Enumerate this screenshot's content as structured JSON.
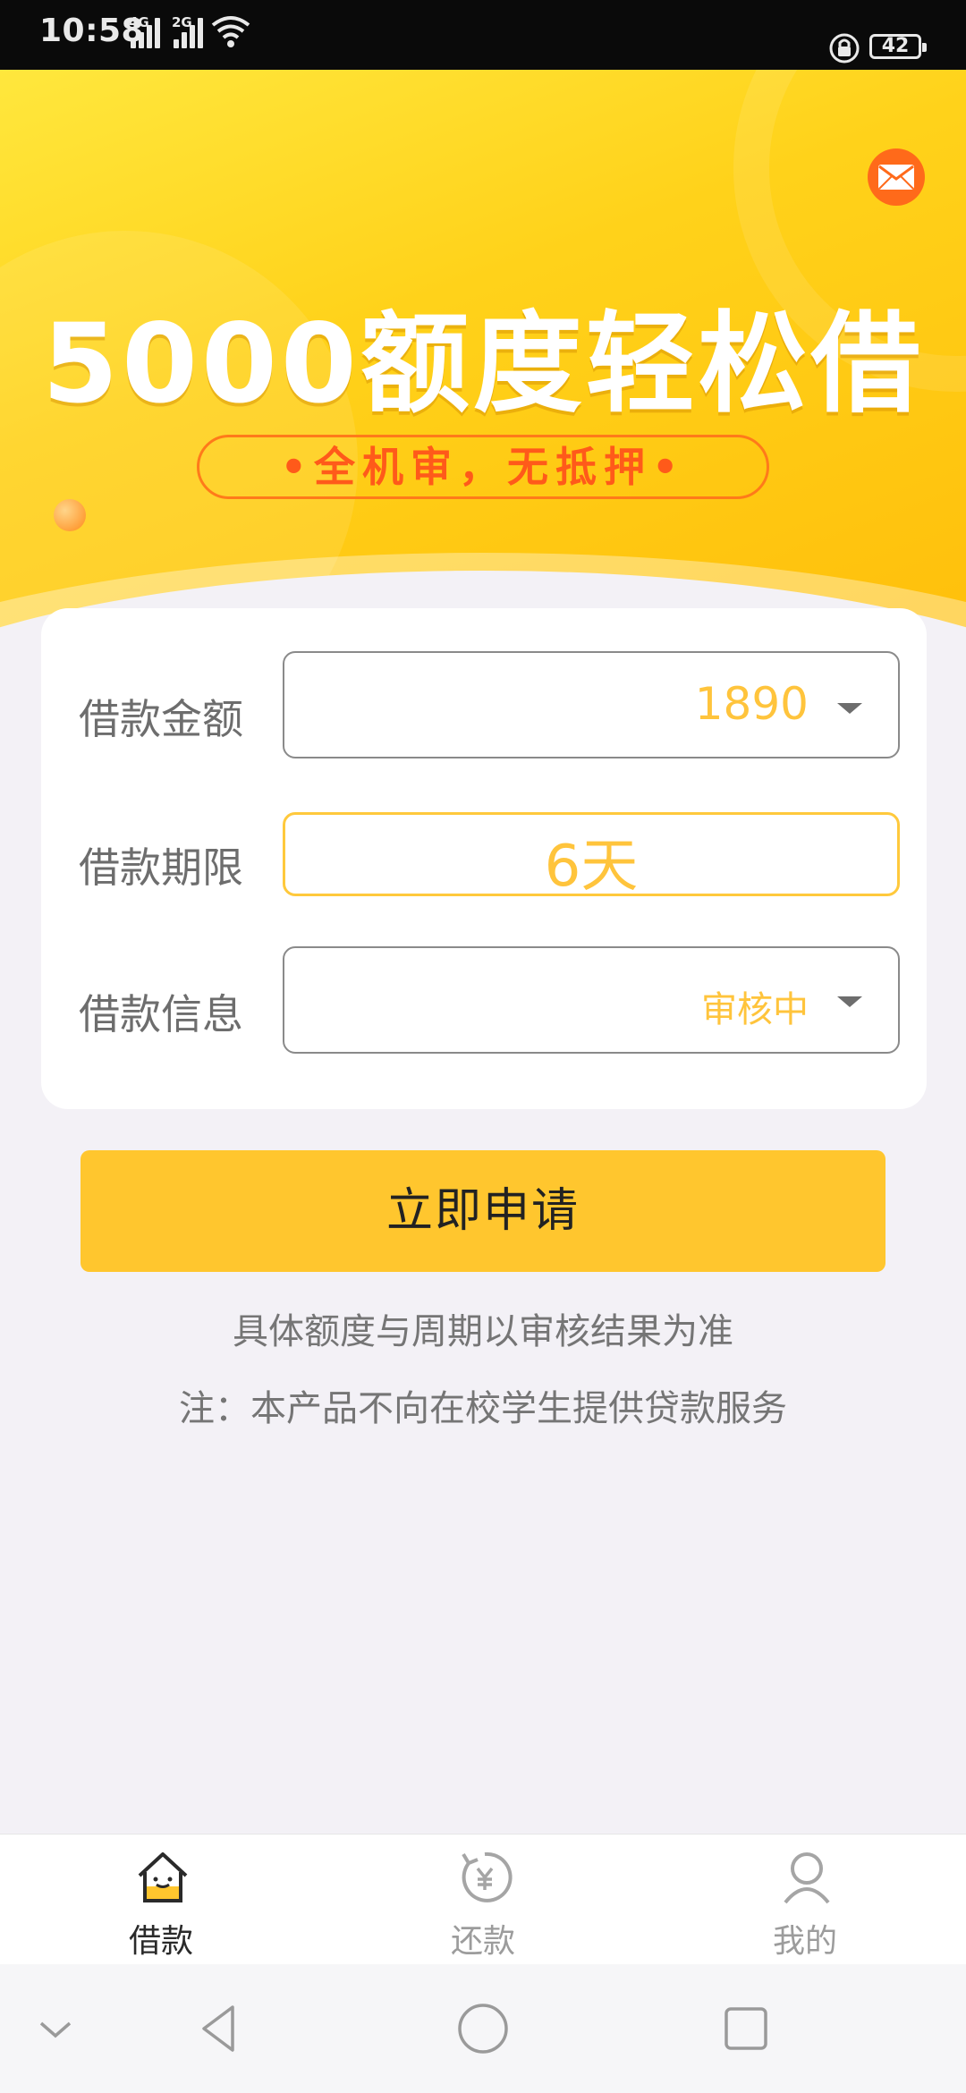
{
  "status_bar": {
    "time": "10:58",
    "sim1": "4G",
    "sim2": "2G",
    "battery": "42"
  },
  "banner": {
    "headline": "5000额度轻松借",
    "tagline": "•全机审，无抵押•",
    "mail_icon": "mail-icon"
  },
  "form": {
    "amount": {
      "label": "借款金额",
      "value": "1890"
    },
    "term": {
      "label": "借款期限",
      "value": "6天"
    },
    "info": {
      "label": "借款信息",
      "value": "审核中"
    }
  },
  "apply_button": "立即申请",
  "notes": {
    "line1": "具体额度与周期以审核结果为准",
    "line2": "注：本产品不向在校学生提供贷款服务"
  },
  "tabs": [
    {
      "label": "借款",
      "icon": "home-icon",
      "active": true
    },
    {
      "label": "还款",
      "icon": "repay-icon",
      "active": false
    },
    {
      "label": "我的",
      "icon": "user-icon",
      "active": false
    }
  ],
  "colors": {
    "accent": "#ffc62e",
    "value_text": "#ffc43c",
    "tagline": "#ff5a1a"
  }
}
